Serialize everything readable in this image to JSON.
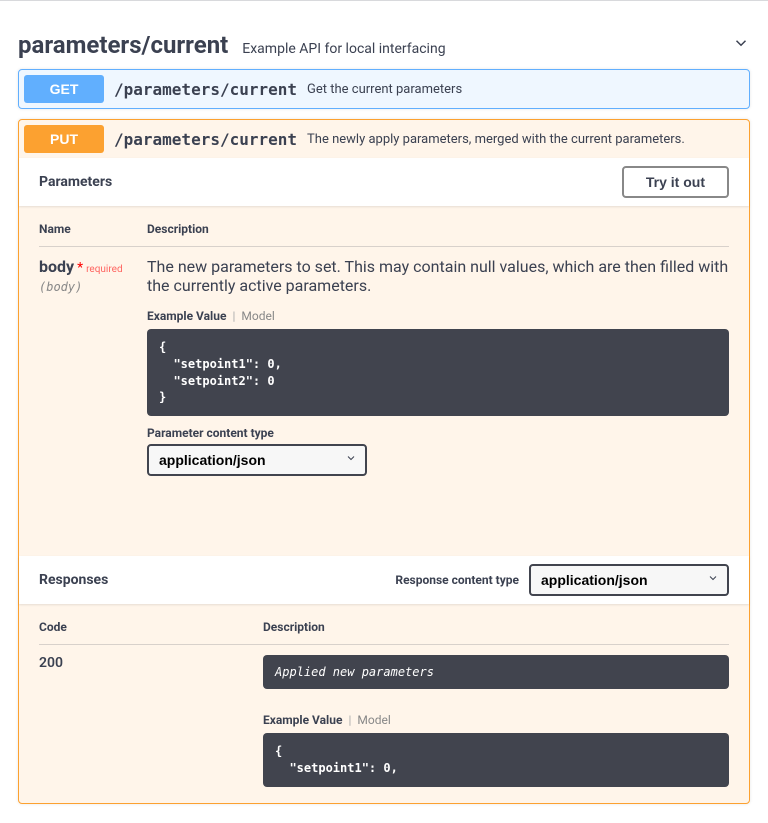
{
  "tag": {
    "name": "parameters/current",
    "description": "Example API for local interfacing"
  },
  "ops": {
    "get": {
      "method": "GET",
      "path": "/parameters/current",
      "summary": "Get the current parameters"
    },
    "put": {
      "method": "PUT",
      "path": "/parameters/current",
      "summary": "The newly apply parameters, merged with the current parameters."
    }
  },
  "parameters": {
    "header": "Parameters",
    "try_it": "Try it out",
    "th_name": "Name",
    "th_desc": "Description",
    "body": {
      "name": "body",
      "star": "*",
      "required": "required",
      "in": "(body)",
      "description": "The new parameters to set. This may contain null values, which are then filled with the currently active parameters.",
      "tab_example": "Example Value",
      "tab_model": "Model",
      "example_code": "{\n  \"setpoint1\": 0,\n  \"setpoint2\": 0\n}",
      "content_type_label": "Parameter content type",
      "content_type_value": "application/json"
    }
  },
  "responses": {
    "header": "Responses",
    "ct_label": "Response content type",
    "ct_value": "application/json",
    "th_code": "Code",
    "th_desc": "Description",
    "row": {
      "code": "200",
      "text": "Applied new parameters",
      "tab_example": "Example Value",
      "tab_model": "Model",
      "example_code": "{\n  \"setpoint1\": 0,"
    }
  }
}
